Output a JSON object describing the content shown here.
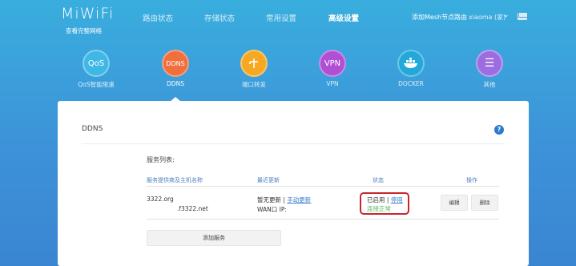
{
  "header": {
    "logo": "MiWiFi",
    "logo_sub": "查看完整网络",
    "nav": [
      "路由状态",
      "存储状态",
      "常用设置",
      "高级设置"
    ],
    "mesh_link": "添加Mesh节点路由",
    "user": "xiaoma (家)"
  },
  "features": [
    {
      "icon_text": "QoS",
      "label": "QoS智能限速",
      "color": "#3fb8e6"
    },
    {
      "icon_text": "DDNS",
      "label": "DDNS",
      "color": "#f06f3d"
    },
    {
      "icon_text": "",
      "label": "端口转发",
      "color": "#f7a823"
    },
    {
      "icon_text": "VPN",
      "label": "VPN",
      "color": "#b04fd4"
    },
    {
      "icon_text": "",
      "label": "DOCKER",
      "color": "#23a9d9"
    },
    {
      "icon_text": "☰",
      "label": "其他",
      "color": "#9b6de0"
    }
  ],
  "panel": {
    "title": "DDNS",
    "help": "?",
    "list_label": "服务列表:",
    "columns": [
      "服务提供商及主机名称",
      "最近更新",
      "状态",
      "操作"
    ],
    "row": {
      "provider": "3322.org",
      "host": ".f3322.net",
      "update_text": "暂无更新",
      "update_link": "手动更新",
      "wan_ip": "WAN口 IP:",
      "status": "已启用",
      "stop_link": "停用",
      "conn_status": "连接正常",
      "edit": "编辑",
      "delete": "删除"
    },
    "add_button": "添加服务"
  }
}
